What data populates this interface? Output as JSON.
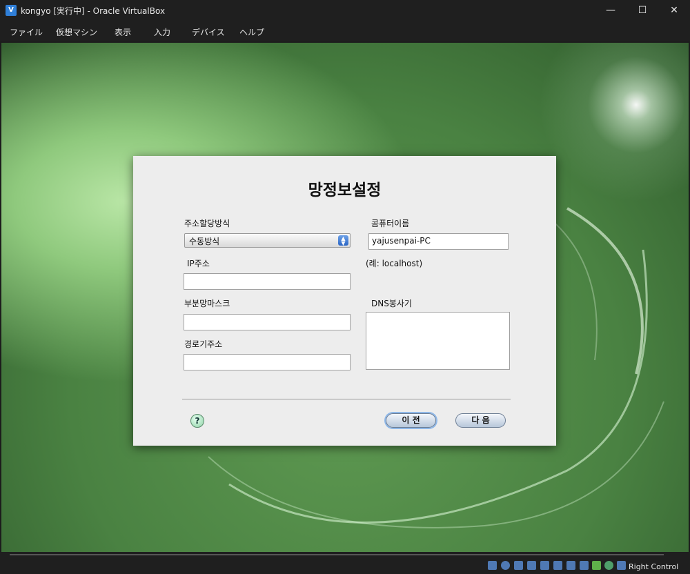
{
  "window": {
    "title": "kongyo [実行中] - Oracle VirtualBox",
    "min_icon": "minimize-icon",
    "max_icon": "maximize-icon",
    "close_icon": "close-icon"
  },
  "menu": [
    "ファイル",
    "仮想マシン",
    "表示",
    "入力",
    "デバイス",
    "ヘルプ"
  ],
  "dialog": {
    "title": "망정보설정",
    "address_mode_label": "주소할당방식",
    "address_mode_value": "수동방식",
    "ip_label": "IP주소",
    "ip_value": "",
    "subnet_label": "부분망마스크",
    "subnet_value": "",
    "gateway_label": "경로기주소",
    "gateway_value": "",
    "computer_name_label": "콤퓨터이름",
    "computer_name_value": "yajusenpai-PC",
    "example_text": "(례: localhost)",
    "dns_label": "DNS봉사기",
    "dns_value": "",
    "help_label": "?",
    "prev_button": "이 전",
    "next_button": "다 음"
  },
  "statusbar": {
    "host_key": "Right Control"
  }
}
